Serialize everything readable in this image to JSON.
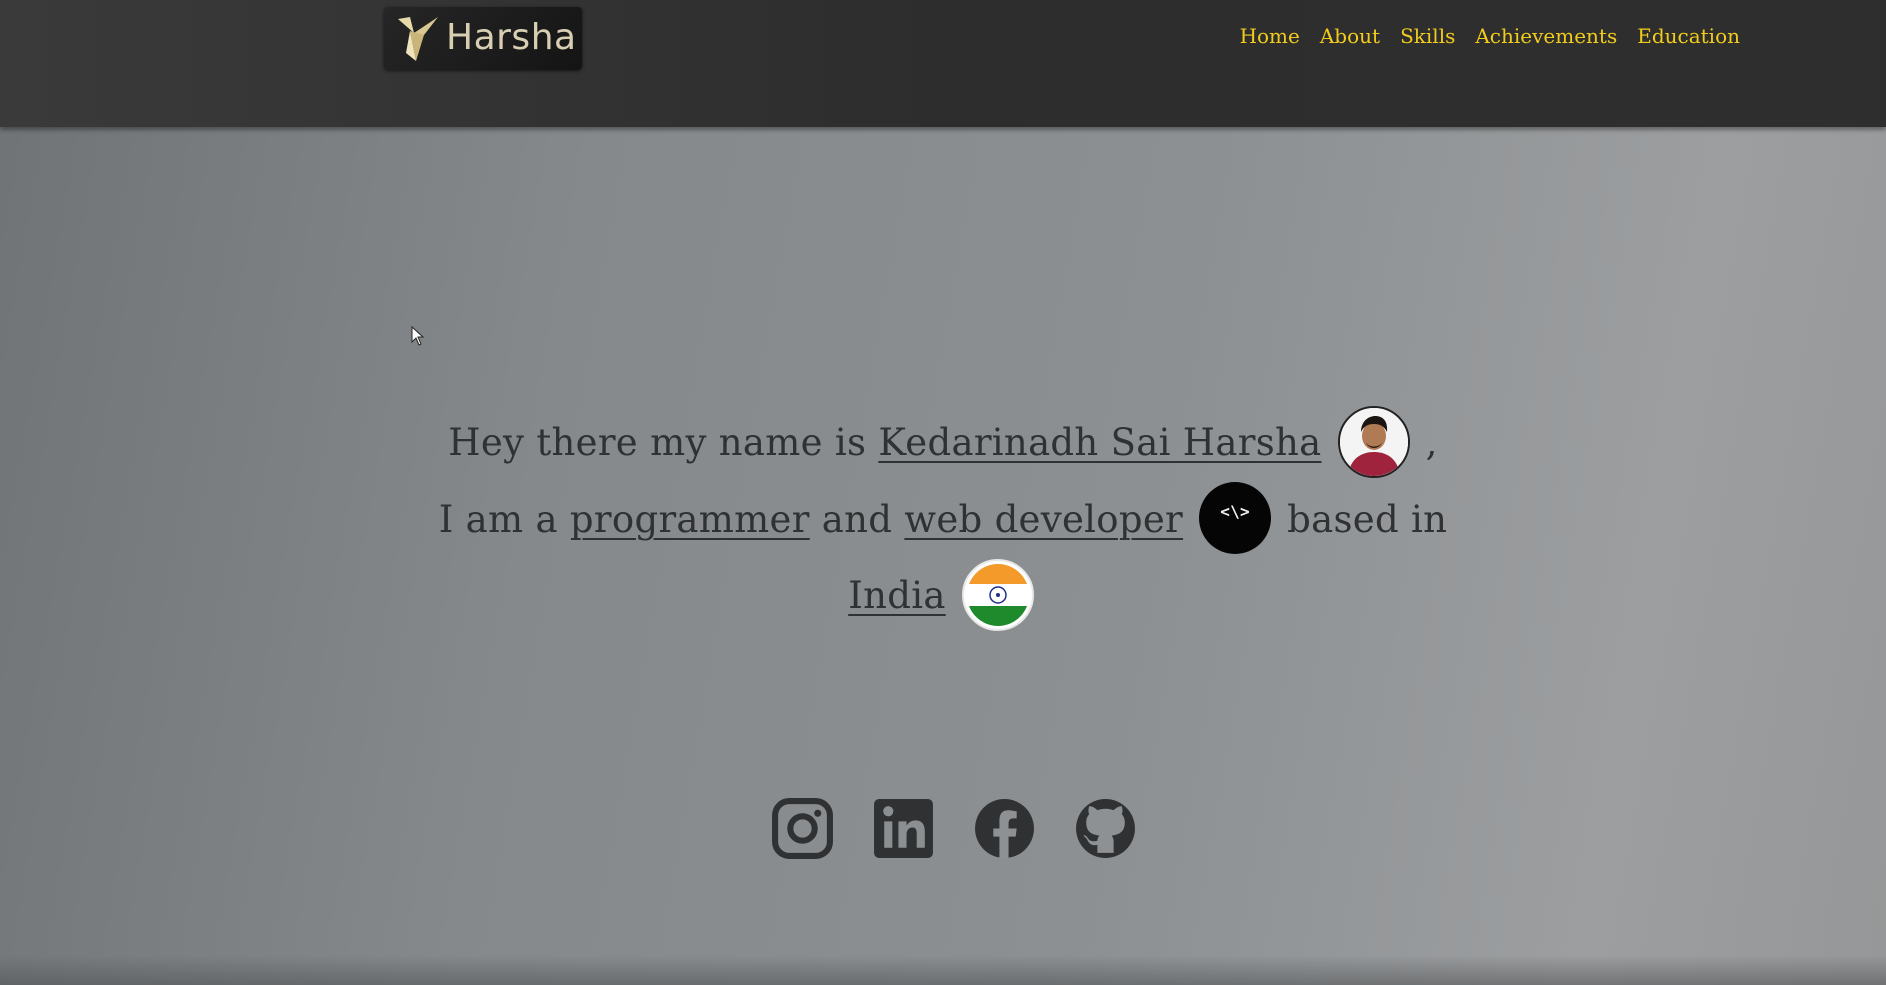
{
  "header": {
    "logo_text": "Harsha",
    "nav": [
      {
        "label": "Home"
      },
      {
        "label": "About"
      },
      {
        "label": "Skills"
      },
      {
        "label": "Achievements"
      },
      {
        "label": "Education"
      }
    ]
  },
  "hero": {
    "line1_prefix": "Hey there my name is ",
    "name_link": "Kedarinadh Sai Harsha",
    "line1_suffix": " ,",
    "line2_prefix": "I am a ",
    "programmer_link": "programmer",
    "line2_mid": " and ",
    "webdev_link": "web developer",
    "code_badge": "<\\>",
    "line2_suffix": " based in",
    "country_link": "India"
  },
  "socials": [
    {
      "icon": "instagram-icon"
    },
    {
      "icon": "linkedin-icon"
    },
    {
      "icon": "facebook-icon"
    },
    {
      "icon": "github-icon"
    }
  ],
  "colors": {
    "nav_link": "#f2cc1c",
    "header_bg": "#2f2f2f",
    "text": "#2f3133"
  }
}
